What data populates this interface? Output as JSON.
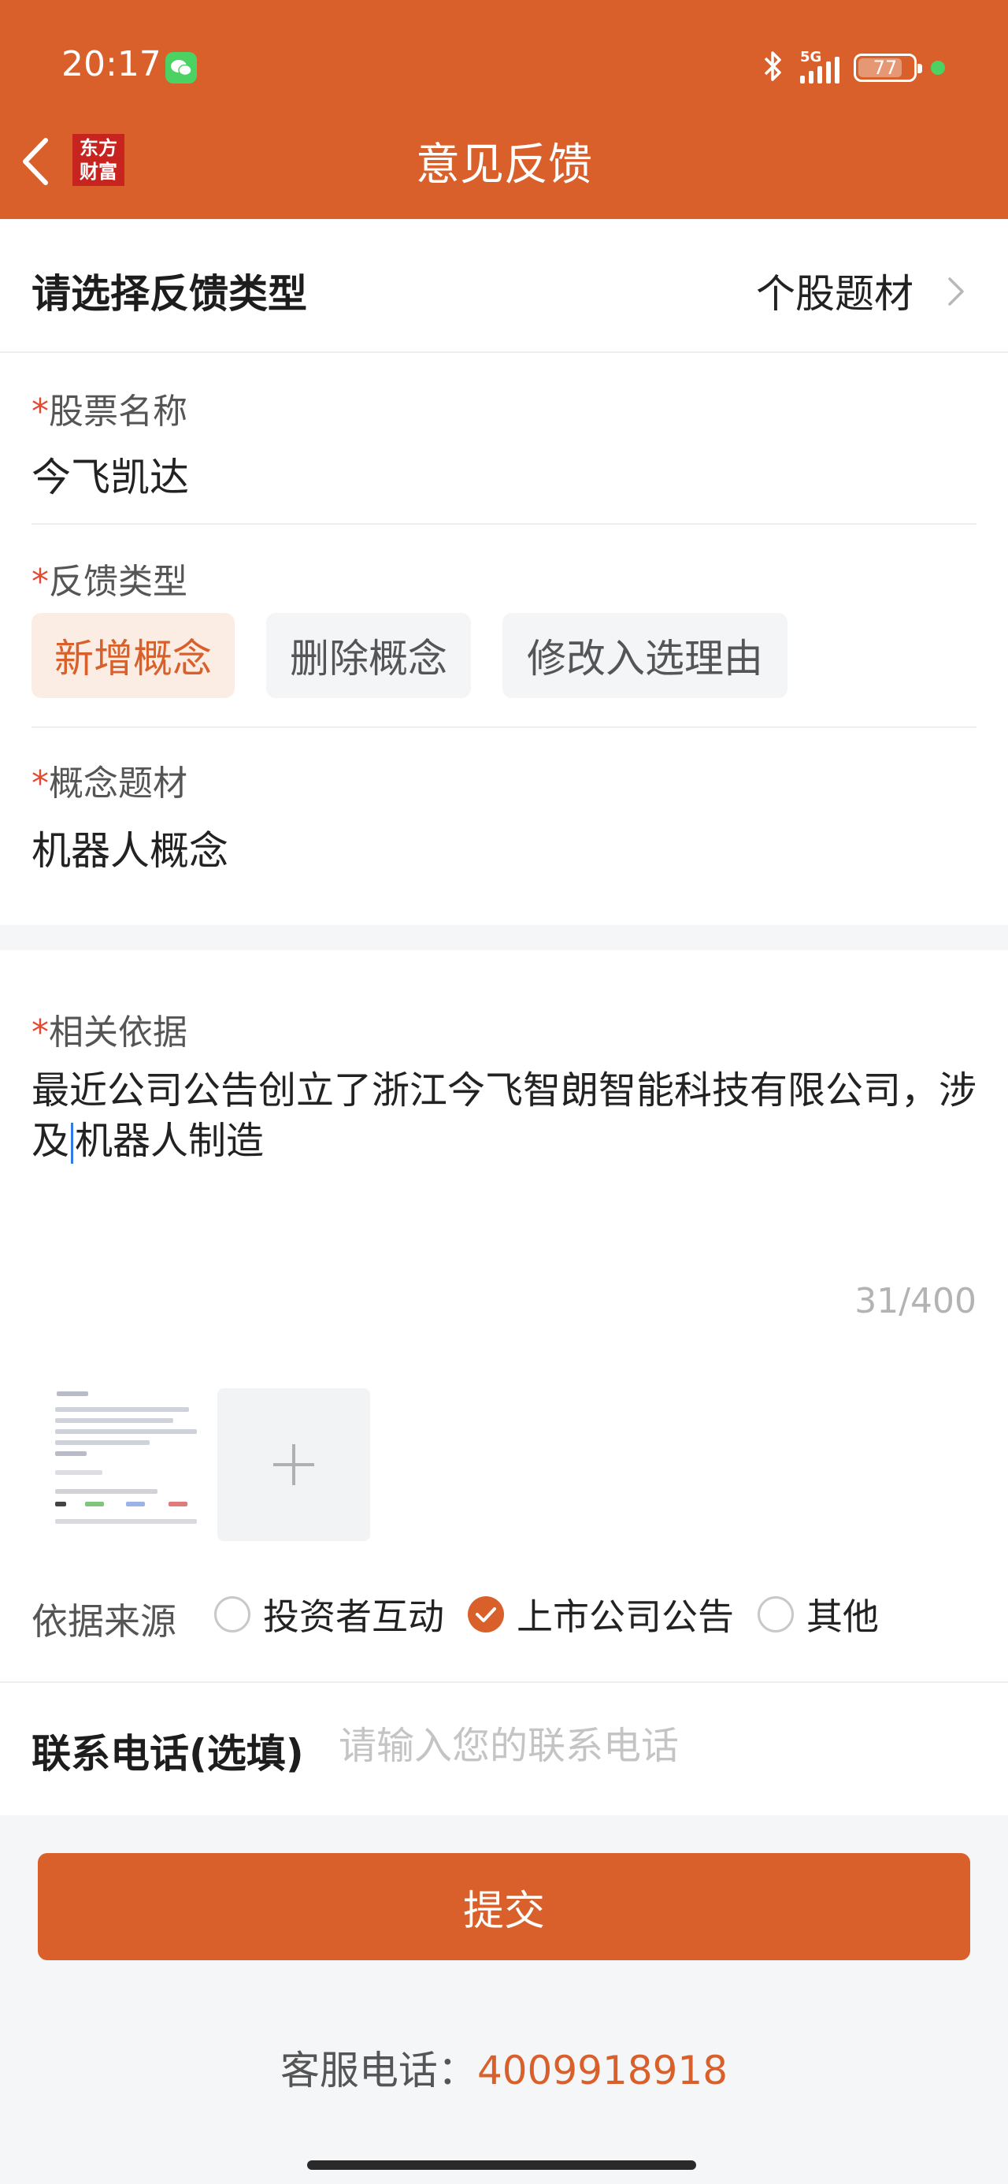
{
  "status_bar": {
    "time": "20:17",
    "network": "5G",
    "battery": "77",
    "battery_level": 0.77
  },
  "nav": {
    "title": "意见反馈",
    "logo_line1": "东方",
    "logo_line2": "财富"
  },
  "feedback_type": {
    "label": "请选择反馈类型",
    "value": "个股题材"
  },
  "stock": {
    "required": "*",
    "label": "股票名称",
    "value": "今飞凯达"
  },
  "category": {
    "required": "*",
    "label": "反馈类型",
    "options": [
      "新增概念",
      "删除概念",
      "修改入选理由"
    ],
    "selected": "新增概念"
  },
  "concept": {
    "required": "*",
    "label": "概念题材",
    "value": "机器人概念"
  },
  "basis": {
    "required": "*",
    "label": "相关依据",
    "text_before_cursor": "最近公司公告创立了浙江今飞智朗智能科技有限公司，涉及",
    "text_after_cursor": "机器人制造",
    "counter": "31/400"
  },
  "source": {
    "label": "依据来源",
    "options": [
      "投资者互动",
      "上市公司公告",
      "其他"
    ],
    "selected": "上市公司公告"
  },
  "phone": {
    "label": "联系电话(选填)",
    "placeholder": "请输入您的联系电话"
  },
  "submit_label": "提交",
  "service": {
    "label": "客服电话：",
    "number": "4009918918"
  },
  "colors": {
    "brand": "#d9602a",
    "required": "#e2492f",
    "logo": "#c8241f"
  }
}
